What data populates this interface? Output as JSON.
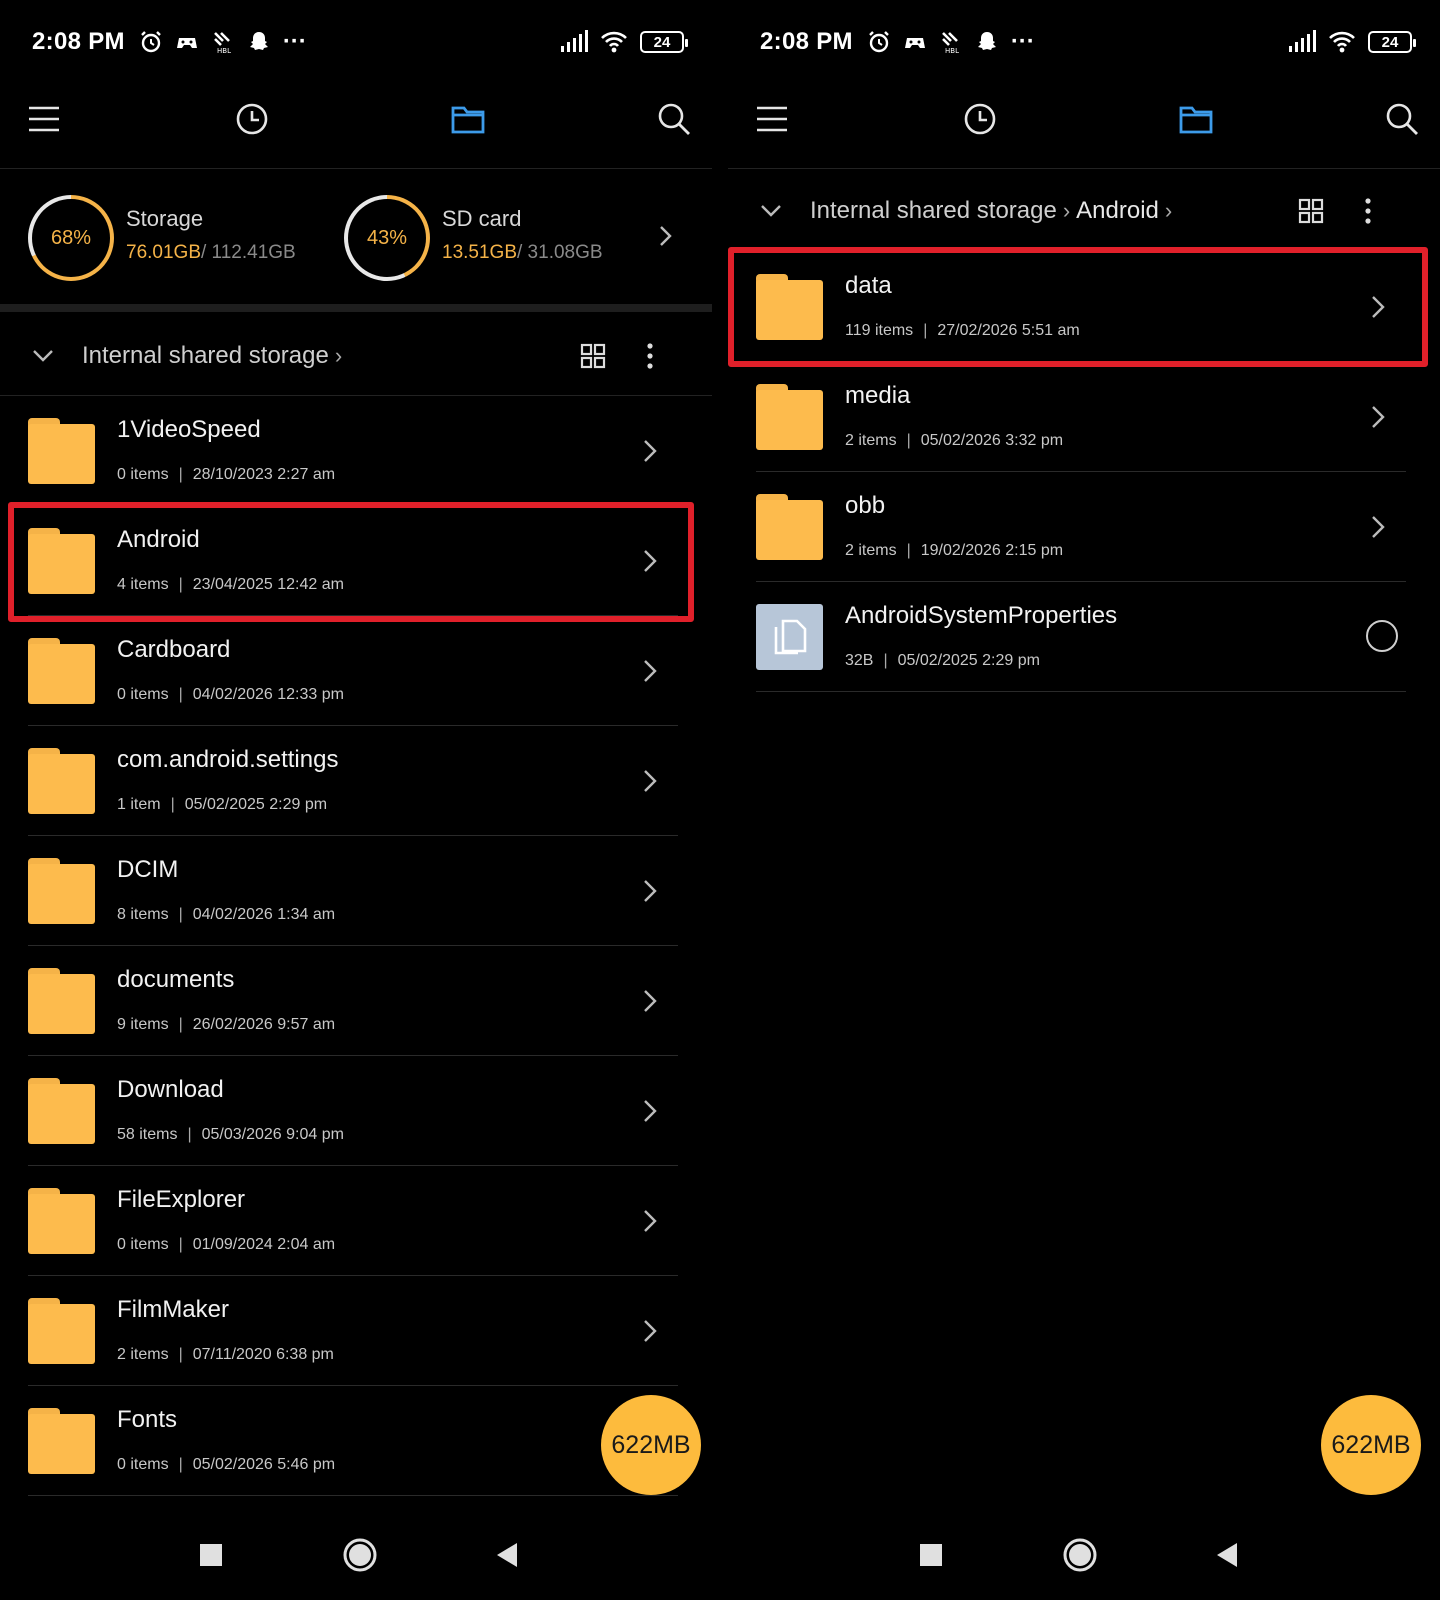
{
  "status": {
    "time": "2:08 PM",
    "battery": "24",
    "more": "···"
  },
  "left": {
    "storage": {
      "internal": {
        "percent": "68%",
        "percent_value": 68,
        "label": "Storage",
        "used": "76.01GB",
        "total": "/ 112.41GB"
      },
      "sd": {
        "percent": "43%",
        "percent_value": 43,
        "label": "SD card",
        "used": "13.51GB",
        "total": "/ 31.08GB"
      }
    },
    "breadcrumb": [
      "Internal shared storage"
    ],
    "items": [
      {
        "name": "1VideoSpeed",
        "count": "0 items",
        "date": "28/10/2023 2:27 am"
      },
      {
        "name": "Android",
        "count": "4 items",
        "date": "23/04/2025 12:42 am"
      },
      {
        "name": "Cardboard",
        "count": "0 items",
        "date": "04/02/2026 12:33 pm"
      },
      {
        "name": "com.android.settings",
        "count": "1 item",
        "date": "05/02/2025 2:29 pm"
      },
      {
        "name": "DCIM",
        "count": "8 items",
        "date": "04/02/2026 1:34 am"
      },
      {
        "name": "documents",
        "count": "9 items",
        "date": "26/02/2026 9:57 am"
      },
      {
        "name": "Download",
        "count": "58 items",
        "date": "05/03/2026 9:04 pm"
      },
      {
        "name": "FileExplorer",
        "count": "0 items",
        "date": "01/09/2024 2:04 am"
      },
      {
        "name": "FilmMaker",
        "count": "2 items",
        "date": "07/11/2020 6:38 pm"
      },
      {
        "name": "Fonts",
        "count": "0 items",
        "date": "05/02/2026 5:46 pm"
      }
    ],
    "fab": "622MB"
  },
  "right": {
    "breadcrumb": [
      "Internal shared storage",
      "Android"
    ],
    "items": [
      {
        "name": "data",
        "count": "119 items",
        "date": "27/02/2026 5:51 am",
        "type": "folder"
      },
      {
        "name": "media",
        "count": "2 items",
        "date": "05/02/2026 3:32 pm",
        "type": "folder"
      },
      {
        "name": "obb",
        "count": "2 items",
        "date": "19/02/2026 2:15 pm",
        "type": "folder"
      },
      {
        "name": "AndroidSystemProperties",
        "count": "32B",
        "date": "05/02/2025 2:29 pm",
        "type": "file"
      }
    ],
    "fab": "622MB"
  },
  "colors": {
    "accent": "#f5b348",
    "folder": "#fdbb4d",
    "highlight": "#e0202a",
    "active_tab": "#3d9be9"
  }
}
